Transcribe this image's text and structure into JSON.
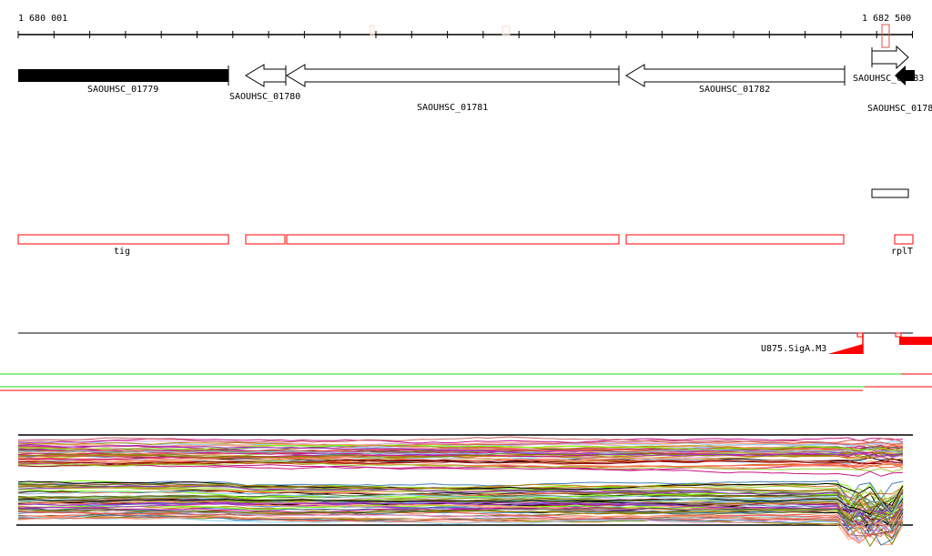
{
  "ruler": {
    "start_label": "1 680 001",
    "end_label": "1 682 500"
  },
  "genes": [
    {
      "id": "SAOUHSC_01779",
      "strand": "+",
      "style": "filled"
    },
    {
      "id": "SAOUHSC_01780",
      "strand": "-",
      "style": "open"
    },
    {
      "id": "SAOUHSC_01781",
      "strand": "-",
      "style": "open"
    },
    {
      "id": "SAOUHSC_01782",
      "strand": "-",
      "style": "open"
    },
    {
      "id": "SAOUHSC_01783",
      "strand": "+",
      "style": "open"
    },
    {
      "id": "SAOUHSC_0178",
      "strand": "-",
      "style": "filled"
    }
  ],
  "features": [
    {
      "label": "tig"
    },
    {
      "label": "rplT"
    }
  ],
  "regulation": {
    "label": "U875.SigA.M3"
  },
  "colors": {
    "feature": "#ff0000",
    "track_green": "#22dd22",
    "track_red": "#ff0000",
    "marker": "#ff6644"
  }
}
